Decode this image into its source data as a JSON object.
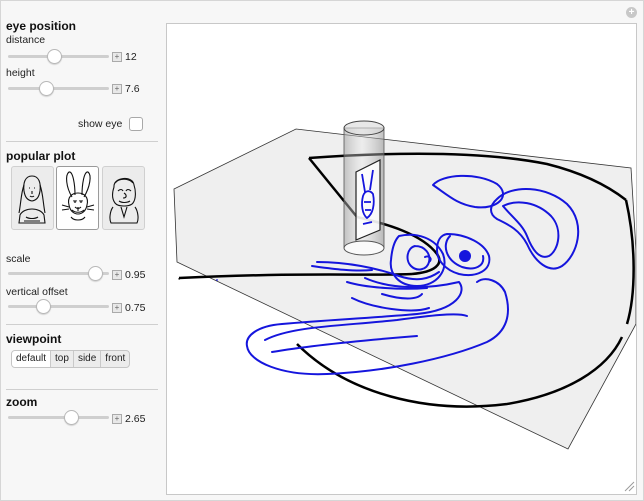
{
  "controls": {
    "eye_position": {
      "title": "eye position",
      "distance": {
        "label": "distance",
        "value": "12",
        "fraction": 0.39
      },
      "height": {
        "label": "height",
        "value": "7.6",
        "fraction": 0.32
      },
      "show_eye": {
        "label": "show eye",
        "checked": false
      }
    },
    "popular_plot": {
      "title": "popular plot",
      "thumbnails": [
        {
          "name": "mona-lisa",
          "selected": false
        },
        {
          "name": "bugs-bunny",
          "selected": true
        },
        {
          "name": "cartoon-man",
          "selected": false
        }
      ]
    },
    "scale": {
      "label": "scale",
      "value": "0.95",
      "fraction": 0.88
    },
    "vertical_offset": {
      "label": "vertical offset",
      "value": "0.75",
      "fraction": 0.31
    },
    "viewpoint": {
      "title": "viewpoint",
      "buttons": [
        "default",
        "top",
        "side",
        "front"
      ],
      "selected": "default"
    },
    "zoom": {
      "title": "zoom",
      "value": "2.65",
      "fraction": 0.61
    }
  },
  "colors": {
    "curve": "#1515dd",
    "plane": "#efefef",
    "accent": "#000000"
  }
}
